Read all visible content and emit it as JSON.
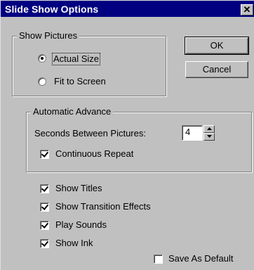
{
  "window": {
    "title": "Slide Show Options",
    "close_glyph": "✕"
  },
  "show_pictures": {
    "group_label": "Show Pictures",
    "options": [
      {
        "label": "Actual Size",
        "checked": true
      },
      {
        "label": "Fit to Screen",
        "checked": false
      }
    ]
  },
  "buttons": {
    "ok_label": "OK",
    "cancel_label": "Cancel"
  },
  "automatic_advance": {
    "group_label": "Automatic Advance",
    "seconds_label": "Seconds Between Pictures:",
    "seconds_value": "4",
    "continuous_repeat_label": "Continuous Repeat",
    "continuous_repeat_checked": true
  },
  "options": [
    {
      "label": "Show Titles",
      "checked": true
    },
    {
      "label": "Show Transition Effects",
      "checked": true
    },
    {
      "label": "Play Sounds",
      "checked": true
    },
    {
      "label": "Show Ink",
      "checked": true
    }
  ],
  "save_as_default": {
    "label": "Save As Default",
    "checked": false
  },
  "icons": {
    "close": "close-icon",
    "spin_up": "spin-up-icon",
    "spin_down": "spin-down-icon"
  }
}
